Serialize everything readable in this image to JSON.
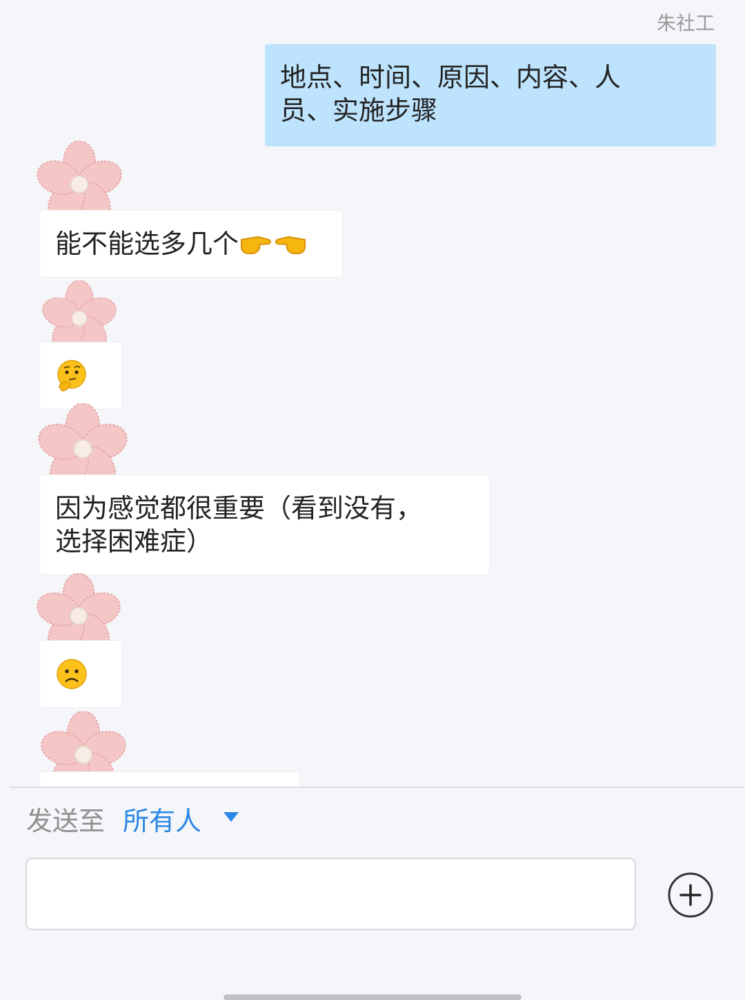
{
  "messages": [
    {
      "direction": "out",
      "sender": "朱社工",
      "text_line1": "地点、时间、原因、内容、人",
      "text_line2": "员、实施步骤"
    },
    {
      "direction": "in",
      "text": "能不能选多几个",
      "emoji": [
        "finger-point-right-icon",
        "finger-point-left-icon"
      ]
    },
    {
      "direction": "in",
      "emoji": [
        "thinking-face-icon"
      ]
    },
    {
      "direction": "in",
      "text_line1": "因为感觉都很重要（看到没有，",
      "text_line2": "选择困难症）"
    },
    {
      "direction": "in",
      "emoji": [
        "frowning-face-icon"
      ]
    }
  ],
  "composer": {
    "send_to_label": "发送至",
    "send_to_target": "所有人",
    "input_value": ""
  },
  "colors": {
    "outgoing_bubble": "#bde3fd",
    "accent": "#2b86e6",
    "background": "#f5f6fa"
  }
}
